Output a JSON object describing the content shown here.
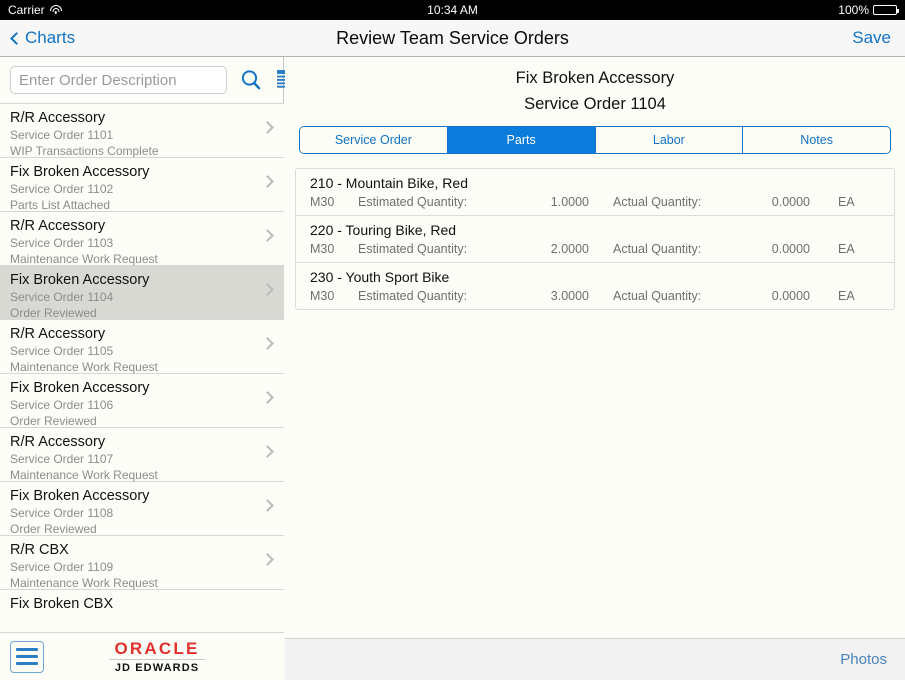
{
  "status_bar": {
    "carrier": "Carrier",
    "wifi_icon": "wifi-icon",
    "time": "10:34 AM",
    "battery_percent": "100%",
    "battery_icon": "battery-full-icon"
  },
  "nav_bar": {
    "back_label": "Charts",
    "back_icon": "chevron-left-icon",
    "title": "Review Team Service Orders",
    "save_label": "Save"
  },
  "search": {
    "placeholder": "Enter Order Description",
    "value": "",
    "search_icon": "search-icon",
    "filter_icon": "filter-list-icon"
  },
  "order_list": [
    {
      "title": "R/R Accessory",
      "order": "Service Order 1101",
      "status": "WIP Transactions Complete",
      "selected": false
    },
    {
      "title": "Fix Broken Accessory",
      "order": "Service Order 1102",
      "status": "Parts List Attached",
      "selected": false
    },
    {
      "title": "R/R Accessory",
      "order": "Service Order 1103",
      "status": "Maintenance Work Request",
      "selected": false
    },
    {
      "title": "Fix Broken Accessory",
      "order": "Service Order 1104",
      "status": "Order Reviewed",
      "selected": true
    },
    {
      "title": "R/R Accessory",
      "order": "Service Order 1105",
      "status": "Maintenance Work Request",
      "selected": false
    },
    {
      "title": "Fix Broken Accessory",
      "order": "Service Order 1106",
      "status": "Order Reviewed",
      "selected": false
    },
    {
      "title": "R/R Accessory",
      "order": "Service Order 1107",
      "status": "Maintenance Work Request",
      "selected": false
    },
    {
      "title": "Fix Broken Accessory",
      "order": "Service Order 1108",
      "status": "Order Reviewed",
      "selected": false
    },
    {
      "title": "R/R CBX",
      "order": "Service Order 1109",
      "status": "Maintenance Work Request",
      "selected": false
    },
    {
      "title": "Fix Broken CBX",
      "order": "",
      "status": "",
      "selected": false
    }
  ],
  "branding": {
    "menu_icon": "hamburger-menu-icon",
    "oracle": "ORACLE",
    "trademark": "®",
    "product": "JD EDWARDS"
  },
  "detail": {
    "title": "Fix Broken Accessory",
    "subtitle": "Service Order 1104",
    "tabs": [
      {
        "label": "Service Order",
        "active": false
      },
      {
        "label": "Parts",
        "active": true
      },
      {
        "label": "Labor",
        "active": false
      },
      {
        "label": "Notes",
        "active": false
      }
    ],
    "parts": [
      {
        "name": "210 - Mountain Bike, Red",
        "um": "M30",
        "estimated_label": "Estimated Quantity:",
        "estimated_value": "1.0000",
        "actual_label": "Actual Quantity:",
        "actual_value": "0.0000",
        "uom": "EA"
      },
      {
        "name": "220 - Touring Bike, Red",
        "um": "M30",
        "estimated_label": "Estimated Quantity:",
        "estimated_value": "2.0000",
        "actual_label": "Actual Quantity:",
        "actual_value": "0.0000",
        "uom": "EA"
      },
      {
        "name": "230 - Youth Sport Bike",
        "um": "M30",
        "estimated_label": "Estimated Quantity:",
        "estimated_value": "3.0000",
        "actual_label": "Actual Quantity:",
        "actual_value": "0.0000",
        "uom": "EA"
      }
    ],
    "footer": {
      "photos_label": "Photos"
    }
  },
  "colors": {
    "accent_blue": "#1273c4",
    "segment_active": "#0b7bdc",
    "oracle_red": "#e0302c",
    "selected_row": "#d9d9d4"
  }
}
